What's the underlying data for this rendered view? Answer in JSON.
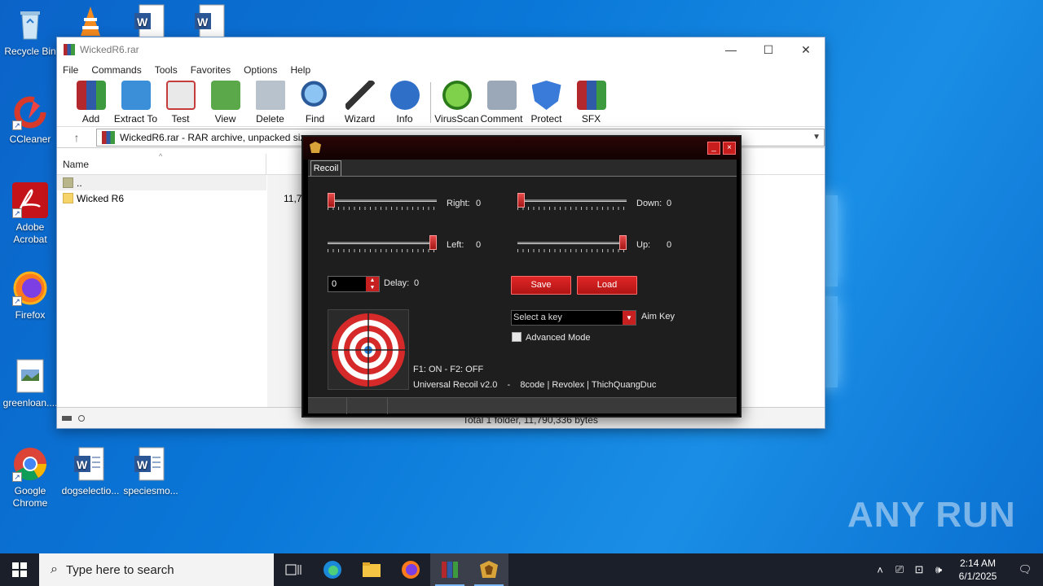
{
  "desktop": {
    "icons": [
      {
        "label": "Recycle Bin"
      },
      {
        "label": "CCleaner"
      },
      {
        "label": "Adobe Acrobat"
      },
      {
        "label": "Firefox"
      },
      {
        "label": "greenloan...."
      },
      {
        "label": "Google Chrome"
      },
      {
        "label": "dogselectio..."
      },
      {
        "label": "speciesmo..."
      }
    ],
    "watermark": "ANY RUN"
  },
  "winrar": {
    "title": "WickedR6.rar",
    "menu": [
      "File",
      "Commands",
      "Tools",
      "Favorites",
      "Options",
      "Help"
    ],
    "toolbar": [
      "Add",
      "Extract To",
      "Test",
      "View",
      "Delete",
      "Find",
      "Wizard",
      "Info",
      "VirusScan",
      "Comment",
      "Protect",
      "SFX"
    ],
    "path": "WickedR6.rar - RAR archive, unpacked size",
    "columns": {
      "name": "Name"
    },
    "rows": [
      {
        "name": "..",
        "size": ""
      },
      {
        "name": "Wicked R6",
        "size": "11,79"
      }
    ],
    "status": "Total 1 folder, 11,790,336 bytes"
  },
  "recoil": {
    "tab": "Recoil",
    "right_label": "Right:",
    "right_value": "0",
    "down_label": "Down:",
    "down_value": "0",
    "left_label": "Left:",
    "left_value": "0",
    "up_label": "Up:",
    "up_value": "0",
    "right_level": 0.0,
    "down_level": 0.0,
    "left_level": 1.0,
    "up_level": 1.0,
    "delay_input": "0",
    "delay_label": "Delay:",
    "delay_value": "0",
    "save": "Save",
    "load": "Load",
    "aim_select": "Select a key",
    "aim_label": "Aim Key",
    "advanced": "Advanced Mode",
    "hotkeys": "F1: ON - F2: OFF",
    "credits": "Universal Recoil v2.0    -    8code | Revolex | ThichQuangDuc",
    "accent": "#c81d1d"
  },
  "taskbar": {
    "search_placeholder": "Type here to search",
    "time": "2:14 AM",
    "date": "6/1/2025"
  }
}
